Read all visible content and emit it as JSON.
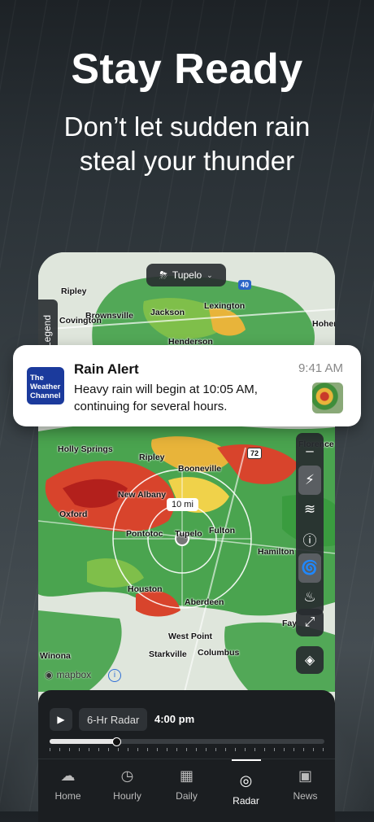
{
  "hero": {
    "headline": "Stay Ready",
    "subline_1": "Don’t let sudden rain",
    "subline_2": "steal your thunder"
  },
  "map": {
    "location_chip": "Tupelo",
    "legend_label": "Legend",
    "scale_label": "10 mi",
    "attribution": "mapbox",
    "cities": [
      "Ripley",
      "Brownsville",
      "Jackson",
      "Lexington",
      "Henderson",
      "Covington",
      "Hohen",
      "Holly Springs",
      "Ripley",
      "Booneville",
      "Florence",
      "New Albany",
      "Oxford",
      "Pontotoc",
      "Tupelo",
      "Fulton",
      "Hamilton",
      "Houston",
      "Aberdeen",
      "West Point",
      "Fay",
      "Starkville",
      "Columbus",
      "Winona"
    ],
    "highway_shields": [
      "40",
      "72"
    ]
  },
  "notification": {
    "app_badge": "The Weather Channel",
    "title": "Rain Alert",
    "time": "9:41 AM",
    "body": "Heavy rain will begin at 10:05 AM, continuing for several hours."
  },
  "player": {
    "radar_label": "6-Hr Radar",
    "time": "4:00 pm",
    "progress": 0.24
  },
  "tabs": [
    {
      "label": "Home",
      "icon": "cloud-icon"
    },
    {
      "label": "Hourly",
      "icon": "clock-icon"
    },
    {
      "label": "Daily",
      "icon": "calendar-icon"
    },
    {
      "label": "Radar",
      "icon": "radar-icon",
      "active": true
    },
    {
      "label": "News",
      "icon": "news-icon"
    }
  ]
}
